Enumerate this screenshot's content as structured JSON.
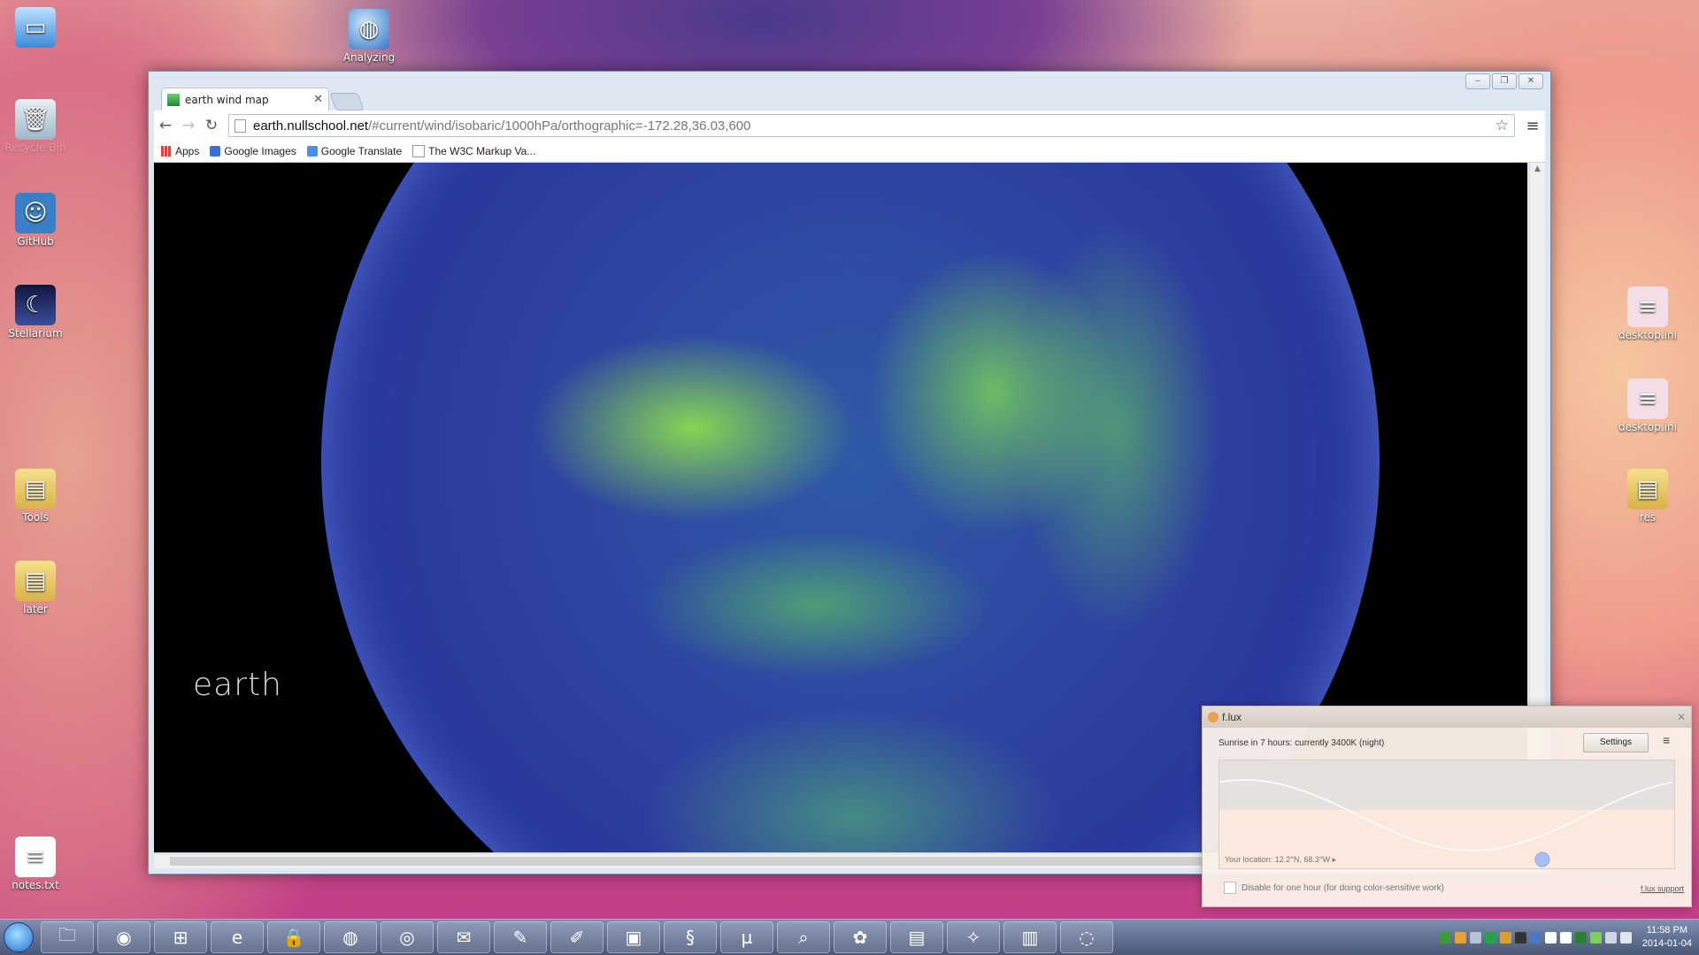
{
  "desktop": {
    "icons": [
      {
        "label": "Computer",
        "icon": "computer-icon"
      },
      {
        "label": "Analyzing",
        "icon": "analyzing-shortcut-icon"
      },
      {
        "label": "Recycle Bin",
        "icon": "recycle-bin-icon"
      },
      {
        "label": "GitHub",
        "icon": "github-icon"
      },
      {
        "label": "Stellarium",
        "icon": "stellarium-icon"
      },
      {
        "label": "Tools",
        "icon": "folder-icon"
      },
      {
        "label": "later",
        "icon": "folder-icon"
      },
      {
        "label": "notes.txt",
        "icon": "text-file-icon"
      },
      {
        "label": "desktop.ini",
        "icon": "ini-file-icon"
      },
      {
        "label": "desktop.ini",
        "icon": "ini-file-icon"
      },
      {
        "label": "res",
        "icon": "folder-shortcut-icon"
      }
    ]
  },
  "browser": {
    "tab_title": "earth wind map",
    "address_host": "earth.nullschool.net",
    "address_path": "/#current/wind/isobaric/1000hPa/orthographic=-172.28,36.03,600",
    "bookmarks": [
      "Apps",
      "Google Images",
      "Google Translate",
      "The W3C Markup Va..."
    ],
    "page_brand": "earth"
  },
  "flux": {
    "title": "f.lux",
    "status": "Sunrise in 7 hours: currently 3400K (night)",
    "settings_label": "Settings",
    "location": "Your location: 12.2°N, 68.3°W",
    "disable_label": "Disable for one hour (for doing color-sensitive work)",
    "support_link": "f.lux support",
    "current_position": 0.71
  },
  "taskbar": {
    "time": "11:58 PM",
    "date": "2014-01-04",
    "apps": [
      "explorer",
      "camera",
      "windows-logo",
      "ie",
      "keepass",
      "globe",
      "chrome",
      "thunderbird",
      "tasks",
      "paint",
      "monitor",
      "python",
      "utorrent",
      "search",
      "gimp",
      "folder",
      "gadget",
      "calculator",
      "app"
    ]
  },
  "colors": {
    "accent": "#2c3a9e",
    "wind": "#8ee05a"
  }
}
